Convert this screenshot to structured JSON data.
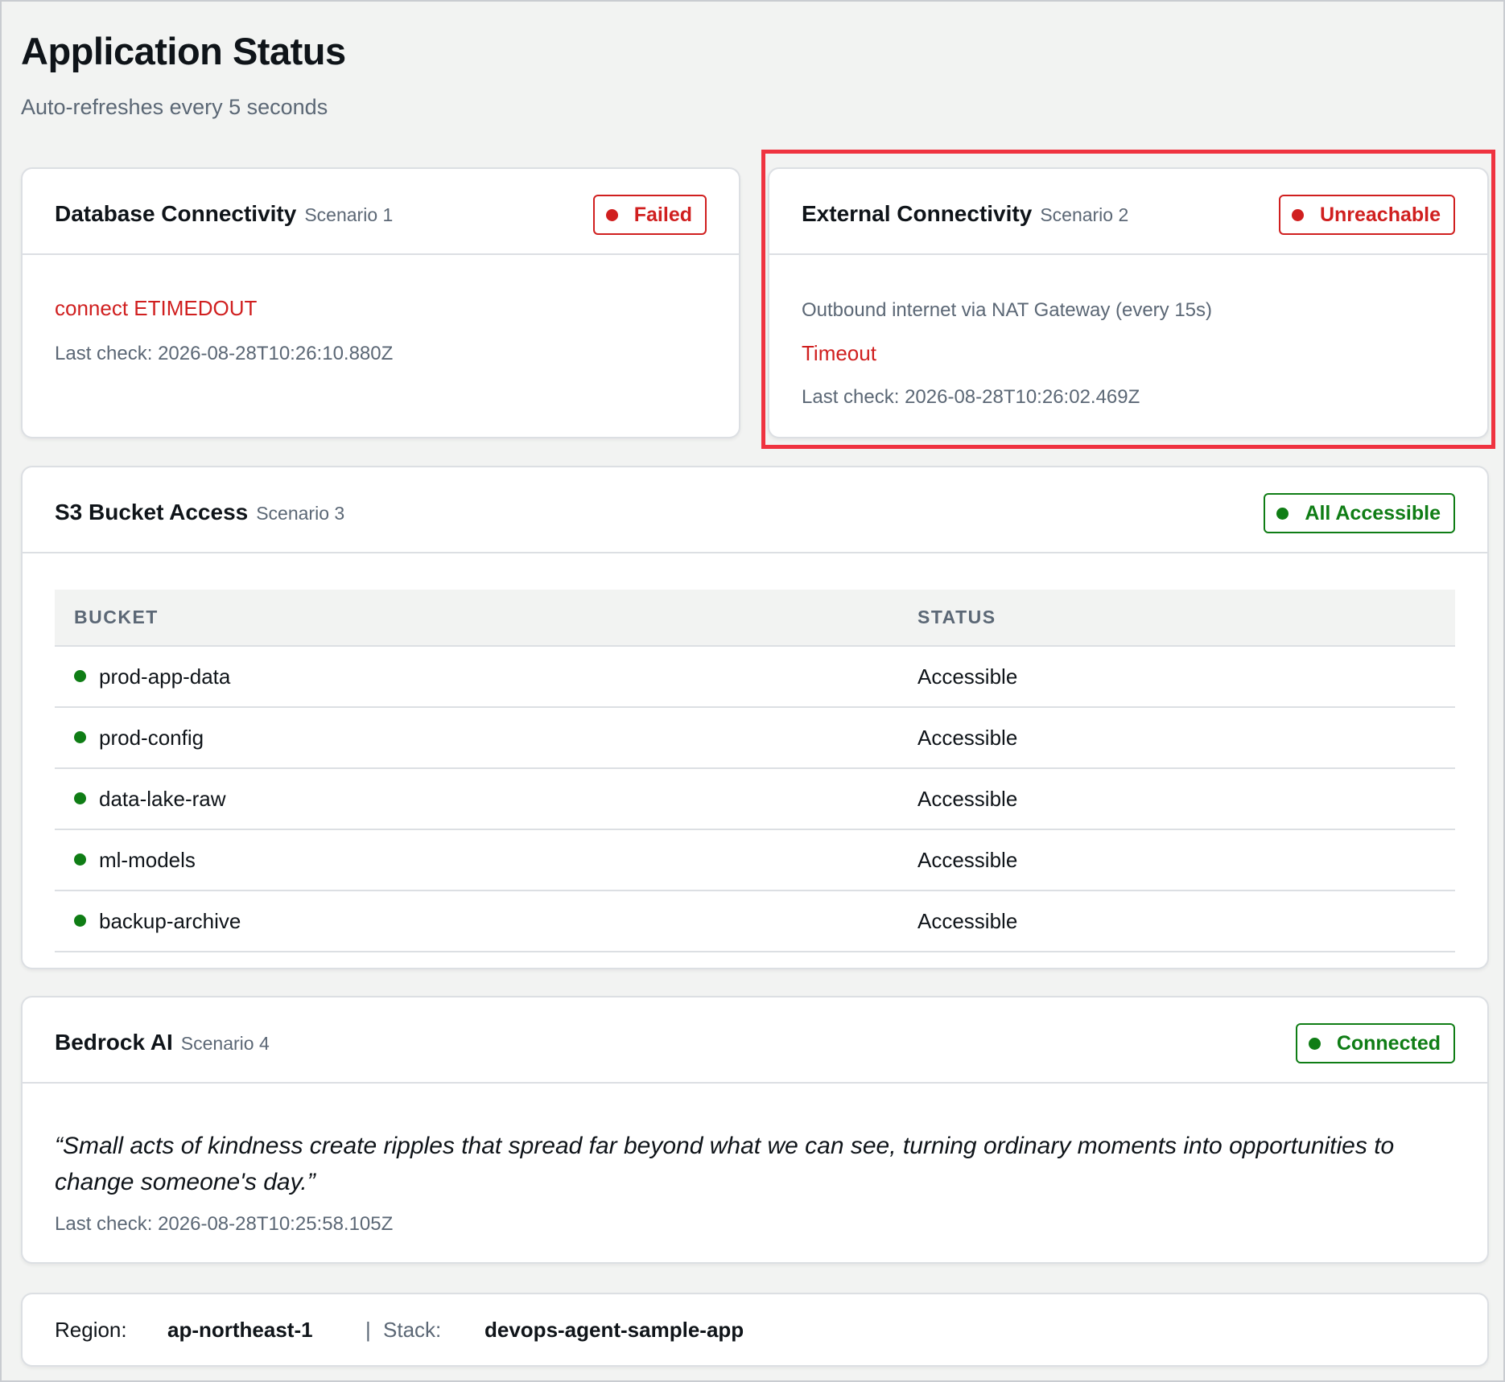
{
  "page": {
    "title": "Application Status",
    "subtitle": "Auto-refreshes every 5 seconds"
  },
  "database": {
    "title": "Database Connectivity",
    "scenario": "Scenario 1",
    "badge": "Failed",
    "error": "connect ETIMEDOUT",
    "last_check": "Last check: 2026-08-28T10:26:10.880Z"
  },
  "external": {
    "title": "External Connectivity",
    "scenario": "Scenario 2",
    "badge": "Unreachable",
    "description": "Outbound internet via NAT Gateway (every 15s)",
    "error": "Timeout",
    "last_check": "Last check: 2026-08-28T10:26:02.469Z"
  },
  "s3": {
    "title": "S3 Bucket Access",
    "scenario": "Scenario 3",
    "badge": "All Accessible",
    "columns": [
      "BUCKET",
      "STATUS"
    ],
    "rows": [
      {
        "bucket": "prod-app-data",
        "status": "Accessible"
      },
      {
        "bucket": "prod-config",
        "status": "Accessible"
      },
      {
        "bucket": "data-lake-raw",
        "status": "Accessible"
      },
      {
        "bucket": "ml-models",
        "status": "Accessible"
      },
      {
        "bucket": "backup-archive",
        "status": "Accessible"
      }
    ]
  },
  "bedrock": {
    "title": "Bedrock AI",
    "scenario": "Scenario 4",
    "badge": "Connected",
    "quote": "“Small acts of kindness create ripples that spread far beyond what we can see, turning ordinary moments into opportunities to change someone's day.”",
    "last_check": "Last check: 2026-08-28T10:25:58.105Z"
  },
  "footer": {
    "region_label": "Region:",
    "region_value": "ap-northeast-1",
    "separator": "|",
    "stack_label": "Stack:",
    "stack_value": "devops-agent-sample-app"
  },
  "colors": {
    "error_red": "#d01f1f",
    "ok_green": "#0f7d15",
    "highlight": "#ef3340",
    "muted": "#5b6775"
  }
}
